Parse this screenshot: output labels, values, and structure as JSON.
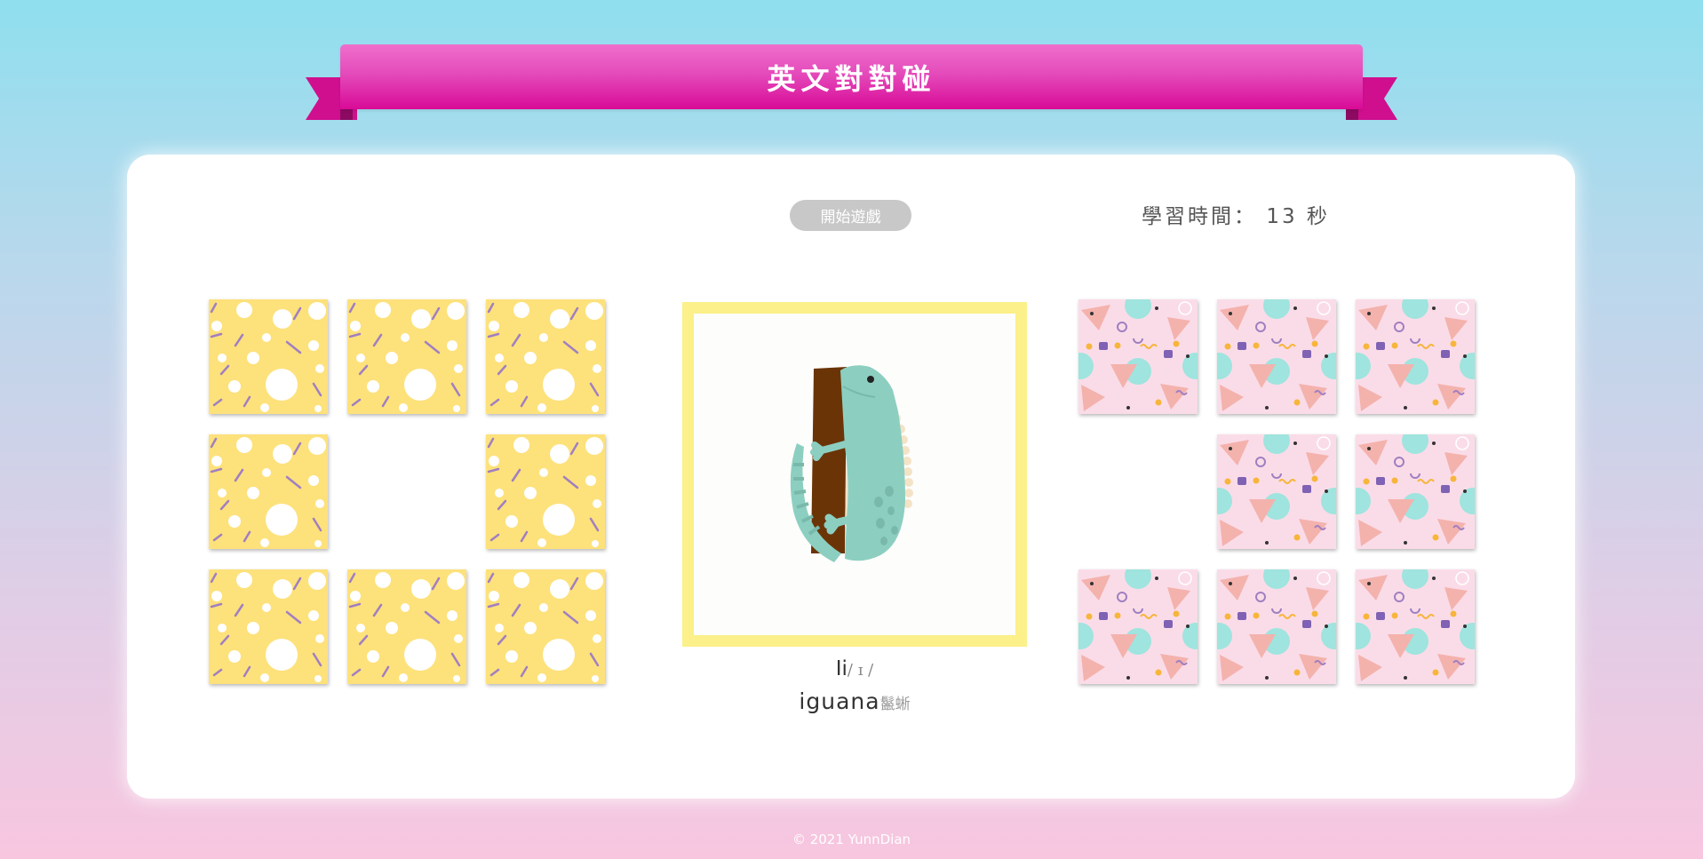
{
  "header": {
    "title": "英文對對碰"
  },
  "controls": {
    "start_label": "開始遊戲"
  },
  "timer": {
    "label": "學習時間：",
    "value": "13",
    "unit": "秒"
  },
  "left_grid": {
    "pattern": "yellow-dots",
    "cells": [
      "card",
      "card",
      "card",
      "card",
      "empty",
      "card",
      "card",
      "card",
      "card"
    ]
  },
  "right_grid": {
    "pattern": "pink-shapes",
    "cells": [
      "card",
      "card",
      "card",
      "empty",
      "card",
      "card",
      "card",
      "card",
      "card"
    ]
  },
  "display": {
    "image": "iguana-illustration",
    "letter": "Ii",
    "ipa": "/ ɪ /",
    "word": "iguana",
    "translation": "鬣蜥"
  },
  "footer": {
    "copyright": "© 2021 YunnDian"
  },
  "colors": {
    "banner": "#e44bbb",
    "frame": "#fbf08a",
    "yellow_card": "#fde17b",
    "pink_card": "#fadce8"
  }
}
